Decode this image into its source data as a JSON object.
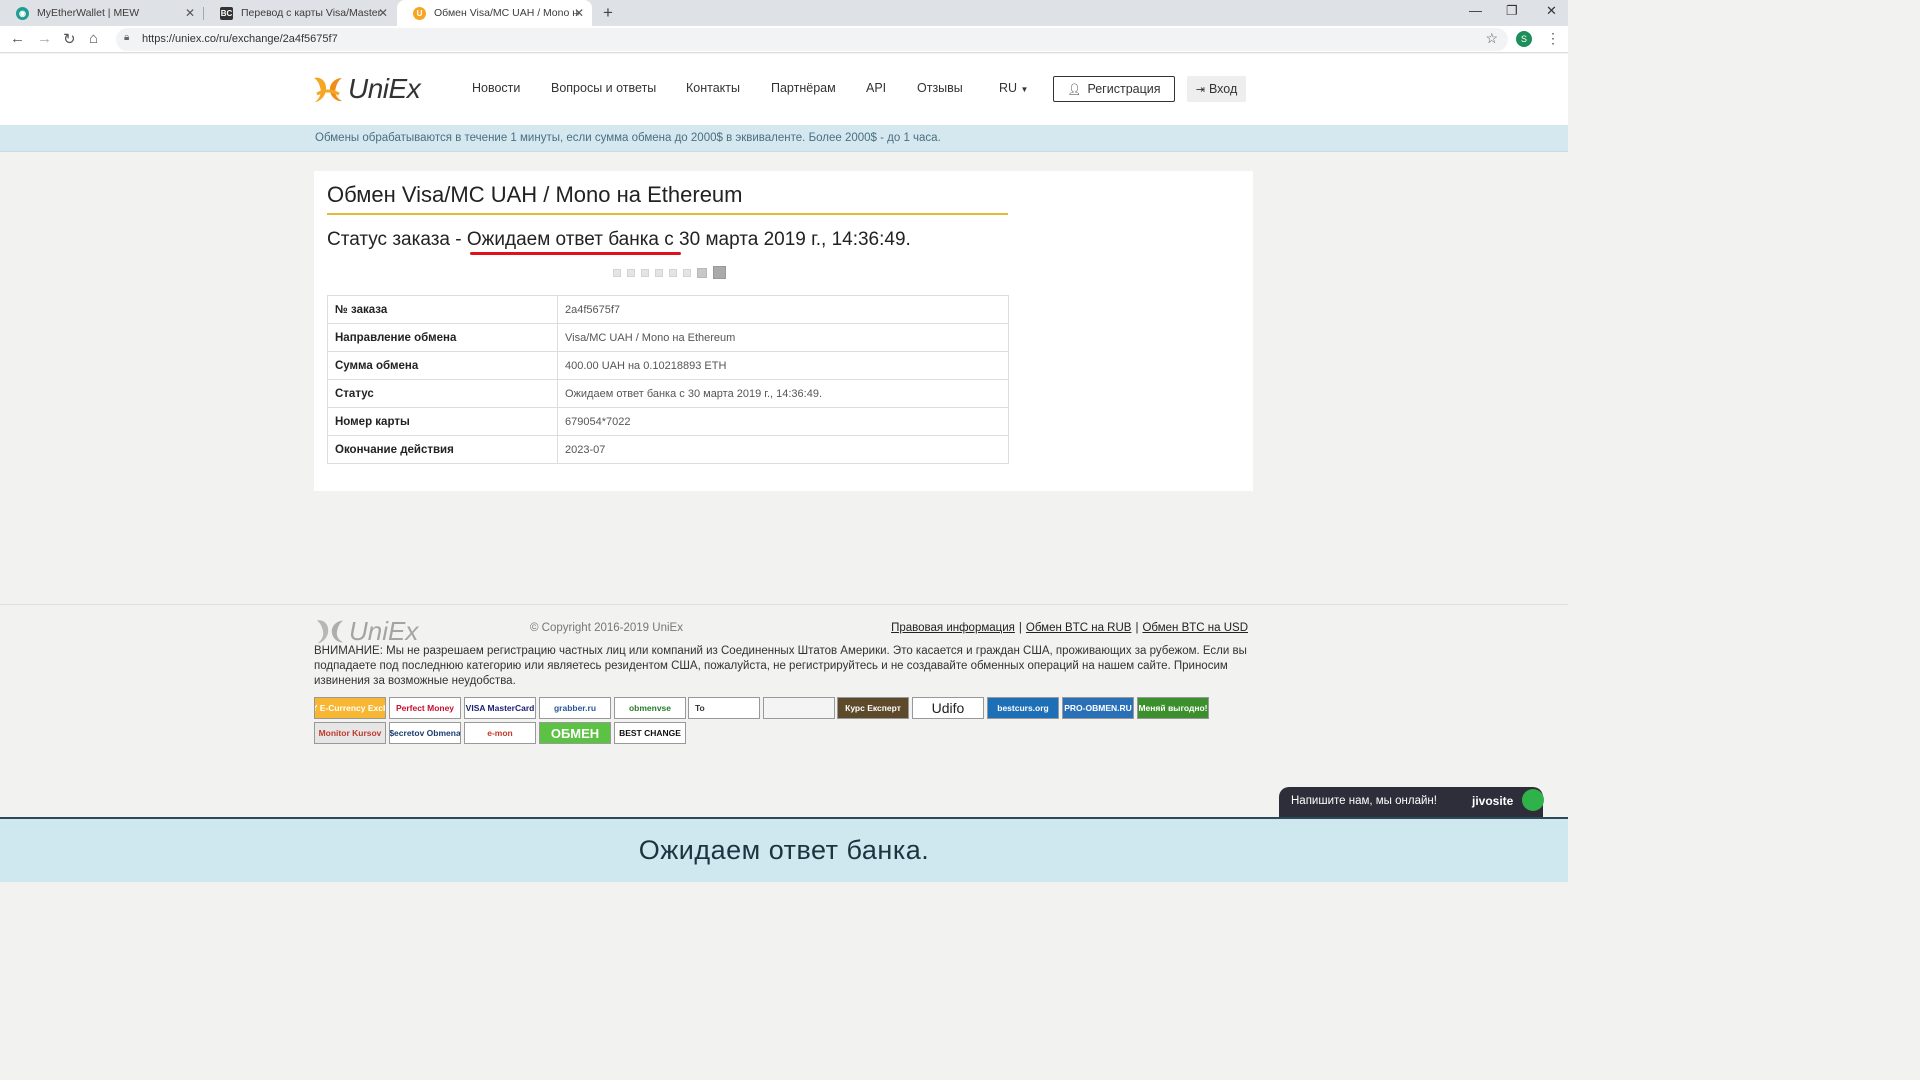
{
  "browser": {
    "tabs": [
      {
        "title": "MyEtherWallet | MEW",
        "favicon": "mew-icon",
        "favicon_color": "#1f9e8f"
      },
      {
        "title": "Перевод с карты Visa/MasterCa",
        "favicon": "bestchange-icon",
        "favicon_color": "#333333"
      },
      {
        "title": "Обмен Visa/MC UAH / Mono на",
        "favicon": "uniex-icon",
        "favicon_color": "#f5a623"
      }
    ],
    "url": "https://uniex.co/ru/exchange/2a4f5675f7",
    "profile_initial": "S"
  },
  "header": {
    "logo_text": "UniEx",
    "nav": [
      "Новости",
      "Вопросы и ответы",
      "Контакты",
      "Партнёрам",
      "API",
      "Отзывы"
    ],
    "lang": "RU",
    "register_label": "Регистрация",
    "login_label": "Вход"
  },
  "notice": "Обмены обрабатываются в течение 1 минуты, если сумма обмена до 2000$ в эквиваленте. Более 2000$ - до 1 часа.",
  "order": {
    "title": "Обмен Visa/MC UAH / Mono на Ethereum",
    "status_prefix": "Статус заказа -",
    "status_text": "Ожидаем ответ банка",
    "status_suffix": "с 30 марта 2019 г., 14:36:49.",
    "progress_step": 8,
    "progress_total": 8,
    "rows": [
      {
        "key": "№ заказа",
        "value": "2a4f5675f7"
      },
      {
        "key": "Направление обмена",
        "value": "Visa/MC UAH / Mono на Ethereum"
      },
      {
        "key": "Сумма обмена",
        "value": "400.00 UAH на 0.10218893 ETH"
      },
      {
        "key": "Статус",
        "value": "Ожидаем ответ банка с 30 марта 2019 г., 14:36:49."
      },
      {
        "key": "Номер карты",
        "value": "679054*7022"
      },
      {
        "key": "Окончание действия",
        "value": "2023-07"
      }
    ]
  },
  "footer": {
    "logo_text": "UniEx",
    "copyright": "© Copyright 2016-2019 UniEx",
    "links": [
      "Правовая информация",
      "Обмен BTC на RUB",
      "Обмен BTC на USD"
    ],
    "warning": "ВНИМАНИЕ: Мы не разрешаем регистрацию частных лиц или компаний из Соединенных Штатов Америки. Это касается и граждан США, проживающих за рубежом. Если вы подпадаете под последнюю категорию или являетесь резидентом США, пожалуйста, не регистрируйтесь и не создавайте обменных операций на нашем сайте. Приносим извинения за возможные неудобства.",
    "banners": [
      {
        "label": "OKPAY E-Currency Exchanger",
        "bg": "#f7b733",
        "fg": "#ffffff"
      },
      {
        "label": "Perfect Money",
        "bg": "#ffffff",
        "fg": "#c8102e"
      },
      {
        "label": "VISA MasterCard",
        "bg": "#ffffff",
        "fg": "#1a1f71"
      },
      {
        "label": "grabber.ru",
        "bg": "#ffffff",
        "fg": "#2b5797"
      },
      {
        "label": "obmenvse",
        "bg": "#ffffff",
        "fg": "#2a7a2a"
      },
      {
        "label": "To",
        "bg": "#ffffff",
        "fg": "#333333"
      },
      {
        "label": "",
        "bg": "#f4f4f4",
        "fg": "#333333"
      },
      {
        "label": "Курс Експерт",
        "bg": "#5c4a2a",
        "fg": "#ffffff"
      },
      {
        "label": "Udifo",
        "bg": "#ffffff",
        "fg": "#222222"
      },
      {
        "label": "bestcurs.org",
        "bg": "#1d6fb8",
        "fg": "#ffffff"
      },
      {
        "label": "PRO-OBMEN.RU",
        "bg": "#2a70b8",
        "fg": "#ffffff"
      },
      {
        "label": "Меняй выгодно!",
        "bg": "#3b8f2c",
        "fg": "#ffffff"
      },
      {
        "label": "Monitor Kursov",
        "bg": "#e6e6e6",
        "fg": "#c0392b"
      },
      {
        "label": "$ecretov Obmena",
        "bg": "#ffffff",
        "fg": "#1a3c6e"
      },
      {
        "label": "e-mon",
        "bg": "#ffffff",
        "fg": "#c0392b"
      },
      {
        "label": "ОБМЕН",
        "bg": "#5cc243",
        "fg": "#ffffff"
      },
      {
        "label": "BEST CHANGE",
        "bg": "#ffffff",
        "fg": "#111111"
      }
    ]
  },
  "chat": {
    "message": "Напишите нам, мы онлайн!",
    "brand": "jivosite"
  },
  "caption": "Ожидаем ответ банка."
}
